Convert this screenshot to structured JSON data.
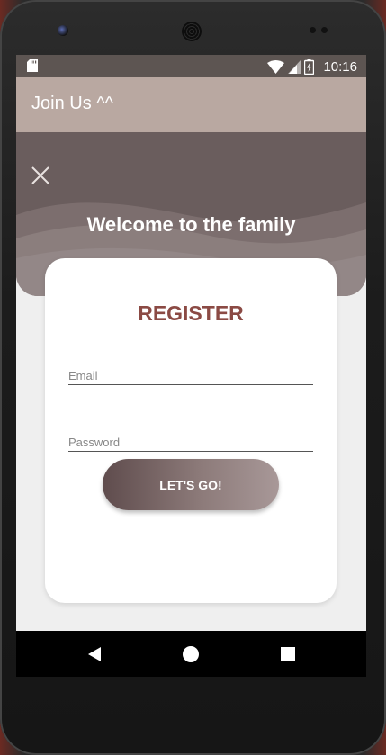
{
  "status_bar": {
    "time": "10:16",
    "icons": [
      "sd-card-icon",
      "wifi-icon",
      "cell-signal-icon",
      "battery-charging-icon"
    ]
  },
  "app_bar": {
    "title": "Join Us ^^"
  },
  "hero": {
    "close_icon": "close-icon",
    "welcome_text": "Welcome to the family"
  },
  "form": {
    "heading": "REGISTER",
    "email_placeholder": "Email",
    "email_value": "",
    "password_placeholder": "Password",
    "password_value": "",
    "submit_label": "LET'S GO!"
  },
  "nav_bar": {
    "buttons": [
      "back-icon",
      "home-icon",
      "recents-icon"
    ]
  },
  "colors": {
    "status_bar": "#5d5552",
    "app_bar": "#b9a8a1",
    "hero": "#6a5d5d",
    "heading": "#8b4a44",
    "button_start": "#5f4c4d",
    "button_end": "#a89898"
  }
}
